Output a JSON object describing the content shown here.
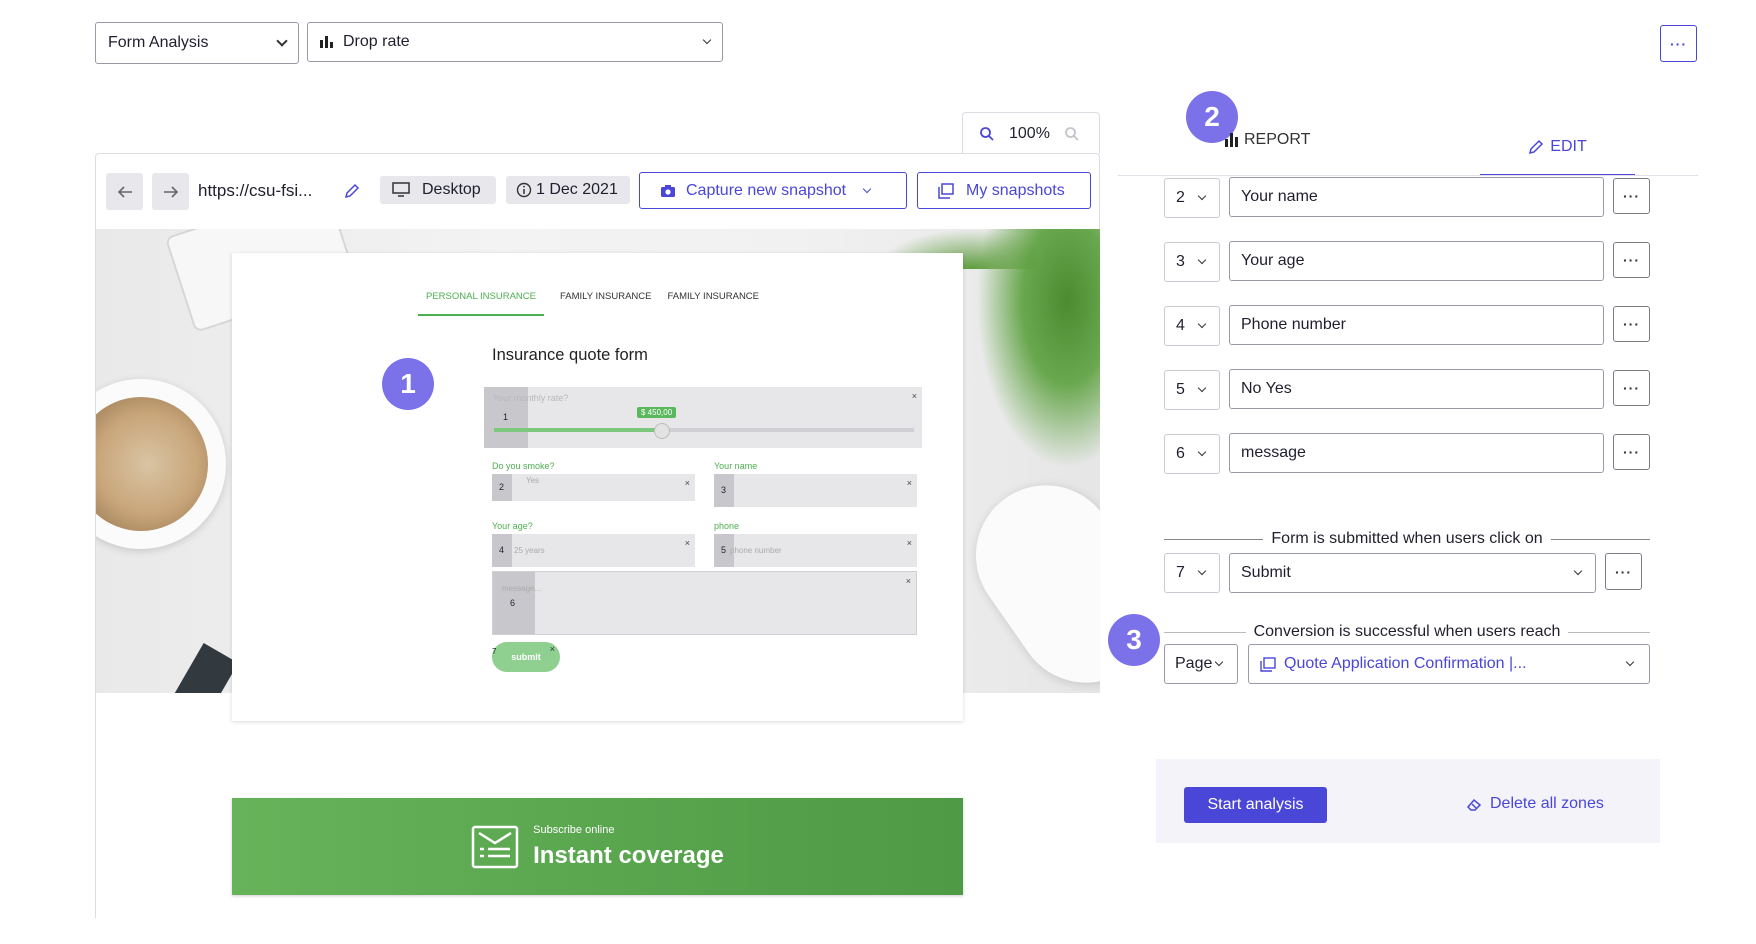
{
  "toolbar": {
    "analysis_select": "Form Analysis",
    "metric_select": "Drop rate",
    "more_label": "···"
  },
  "zoom": {
    "value": "100%"
  },
  "browser": {
    "url": "https://csu-fsi...",
    "device": "Desktop",
    "date": "1 Dec 2021",
    "capture_label": "Capture new snapshot",
    "snapshots_label": "My snapshots"
  },
  "preview": {
    "tabs": [
      "PERSONAL INSURANCE",
      "FAMILY INSURANCE",
      "FAMILY INSURANCE"
    ],
    "form_title": "Insurance quote form",
    "fields": {
      "monthly_rate_label": "Your monthly rate?",
      "rate_value": "$ 450,00",
      "smoke_label": "Do you smoke?",
      "smoke_option": "Yes",
      "name_label": "Your name",
      "age_label": "Your age?",
      "age_placeholder": "25 years",
      "phone_label": "phone",
      "phone_placeholder": "phone number",
      "message_placeholder": "message...",
      "submit": "submit",
      "zone_numbers": [
        "1",
        "2",
        "3",
        "4",
        "5",
        "6",
        "7"
      ]
    },
    "banner": {
      "small": "Subscribe online",
      "big": "Instant coverage"
    }
  },
  "badges": [
    "1",
    "2",
    "3"
  ],
  "tabs": {
    "report": "REPORT",
    "edit": "EDIT"
  },
  "zones": [
    {
      "number": "2",
      "name": "Your name"
    },
    {
      "number": "3",
      "name": "Your age"
    },
    {
      "number": "4",
      "name": "Phone number"
    },
    {
      "number": "5",
      "name": "No Yes"
    },
    {
      "number": "6",
      "name": "message"
    }
  ],
  "submit_section": {
    "heading": "Form is submitted when users click on",
    "number": "7",
    "value": "Submit"
  },
  "conversion_section": {
    "heading": "Conversion is successful when users reach",
    "type": "Page",
    "value": "Quote Application Confirmation |..."
  },
  "actions": {
    "start": "Start analysis",
    "delete": "Delete all zones"
  },
  "colors": {
    "accent": "#4a46d8",
    "badge": "#7b72e9",
    "green": "#5cb85c"
  }
}
